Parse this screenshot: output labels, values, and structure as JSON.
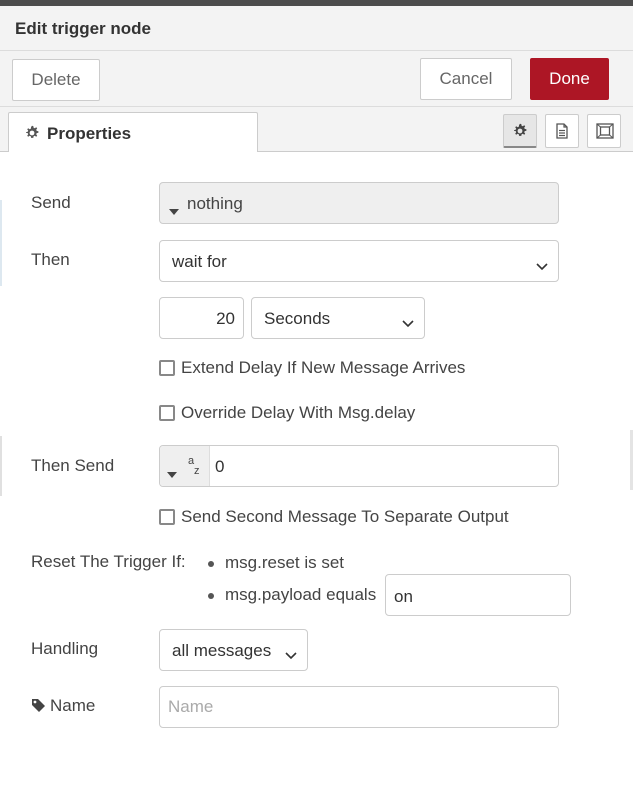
{
  "dialog": {
    "title": "Edit trigger node"
  },
  "buttons": {
    "delete": "Delete",
    "cancel": "Cancel",
    "done": "Done"
  },
  "tabs": [
    {
      "label": "Properties",
      "icon": "gear-icon",
      "active": true
    }
  ],
  "tab_icons": [
    "gear-icon",
    "document-icon",
    "frame-icon"
  ],
  "form": {
    "send": {
      "label": "Send",
      "value": "nothing"
    },
    "then": {
      "label": "Then",
      "value": "wait for"
    },
    "delay": {
      "value": "20",
      "units": "Seconds"
    },
    "extend_delay": {
      "label": "Extend Delay If New Message Arrives",
      "checked": false
    },
    "override_delay": {
      "label": "Override Delay With Msg.delay",
      "checked": false
    },
    "then_send": {
      "label": "Then Send",
      "type_icon": "az",
      "value": "0"
    },
    "second_output": {
      "label": "Send Second Message To Separate Output",
      "checked": false
    },
    "reset": {
      "label": "Reset The Trigger If:",
      "option1": "msg.reset is set",
      "option2": "msg.payload equals",
      "payload_value": "on"
    },
    "handling": {
      "label": "Handling",
      "value": "all messages"
    },
    "name": {
      "label": "Name",
      "placeholder": "Name",
      "value": ""
    }
  },
  "colors": {
    "done_button": "#ad1625",
    "header_bg": "#f3f3f3"
  }
}
